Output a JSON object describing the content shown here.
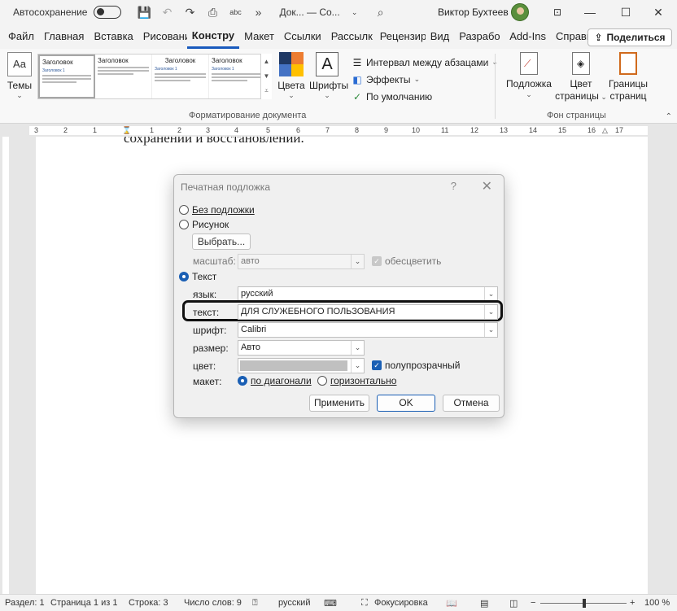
{
  "titlebar": {
    "autosave_label": "Автосохранение",
    "doc_title": "Док... — Со...",
    "user_name": "Виктор Бухтеев",
    "minimize": "—",
    "maximize": "☐",
    "close": "✕"
  },
  "tabs": [
    "Файл",
    "Главная",
    "Вставка",
    "Рисовани",
    "Констру",
    "Макет",
    "Ссылки",
    "Рассылк",
    "Рецензир",
    "Вид",
    "Разрабо",
    "Add-Ins",
    "Справка"
  ],
  "active_tab": "Констру",
  "share_label": "Поделиться",
  "ribbon": {
    "themes_label": "Темы",
    "gallery": [
      {
        "title": "Заголовок",
        "head": "Заголовок 1"
      },
      {
        "title": "Заголовок",
        "head": ""
      },
      {
        "title": "Заголовок",
        "head": "Заголовок 1"
      },
      {
        "title": "Заголовок",
        "head": "Заголовок 1"
      }
    ],
    "colors_label": "Цвета",
    "fonts_label": "Шрифты",
    "paragraph_spacing": "Интервал между абзацами",
    "effects": "Эффекты",
    "default": "По умолчанию",
    "group_format": "Форматирование документа",
    "watermark_label": "Подложка",
    "page_color_label_1": "Цвет",
    "page_color_label_2": "страницы",
    "page_borders_label_1": "Границы",
    "page_borders_label_2": "страниц",
    "group_page_bg": "Фон страницы"
  },
  "ruler_numbers": [
    "3",
    "2",
    "1",
    "1",
    "2",
    "3",
    "4",
    "5",
    "6",
    "7",
    "8",
    "9",
    "10",
    "11",
    "12",
    "13",
    "14",
    "15",
    "16",
    "17"
  ],
  "document": {
    "visible_text": "сохранений и восстановлений."
  },
  "dialog": {
    "title": "Печатная подложка",
    "help": "?",
    "close": "✕",
    "no_watermark": "Без подложки",
    "picture": "Рисунок",
    "choose_button": "Выбрать...",
    "scale_label": "масштаб:",
    "scale_value": "авто",
    "washout_label": "обесцветить",
    "text_option": "Текст",
    "language_label": "язык:",
    "language_value": "русский",
    "text_label": "текст:",
    "text_value": "ДЛЯ СЛУЖЕБНОГО ПОЛЬЗОВАНИЯ",
    "font_label": "шрифт:",
    "font_value": "Calibri",
    "size_label": "размер:",
    "size_value": "Авто",
    "color_label": "цвет:",
    "semitransparent_label": "полупрозрачный",
    "layout_label": "макет:",
    "diagonal_label": "по диагонали",
    "horizontal_label": "горизонтально",
    "apply_button": "Применить",
    "ok_button": "OK",
    "cancel_button": "Отмена",
    "selected_mode": "Текст",
    "selected_layout": "по диагонали",
    "semitransparent_checked": true,
    "color_value_hex": "#c0c0c0"
  },
  "statusbar": {
    "section": "Раздел: 1",
    "page": "Страница 1 из 1",
    "line": "Строка: 3",
    "words": "Число слов: 9",
    "language": "русский",
    "focus": "Фокусировка",
    "zoom": "100 %",
    "zoom_minus": "−",
    "zoom_plus": "+"
  },
  "colors": {
    "accent": "#185abd",
    "dialog_primary": "#1a5fb4",
    "highlight_box": "#111111"
  }
}
